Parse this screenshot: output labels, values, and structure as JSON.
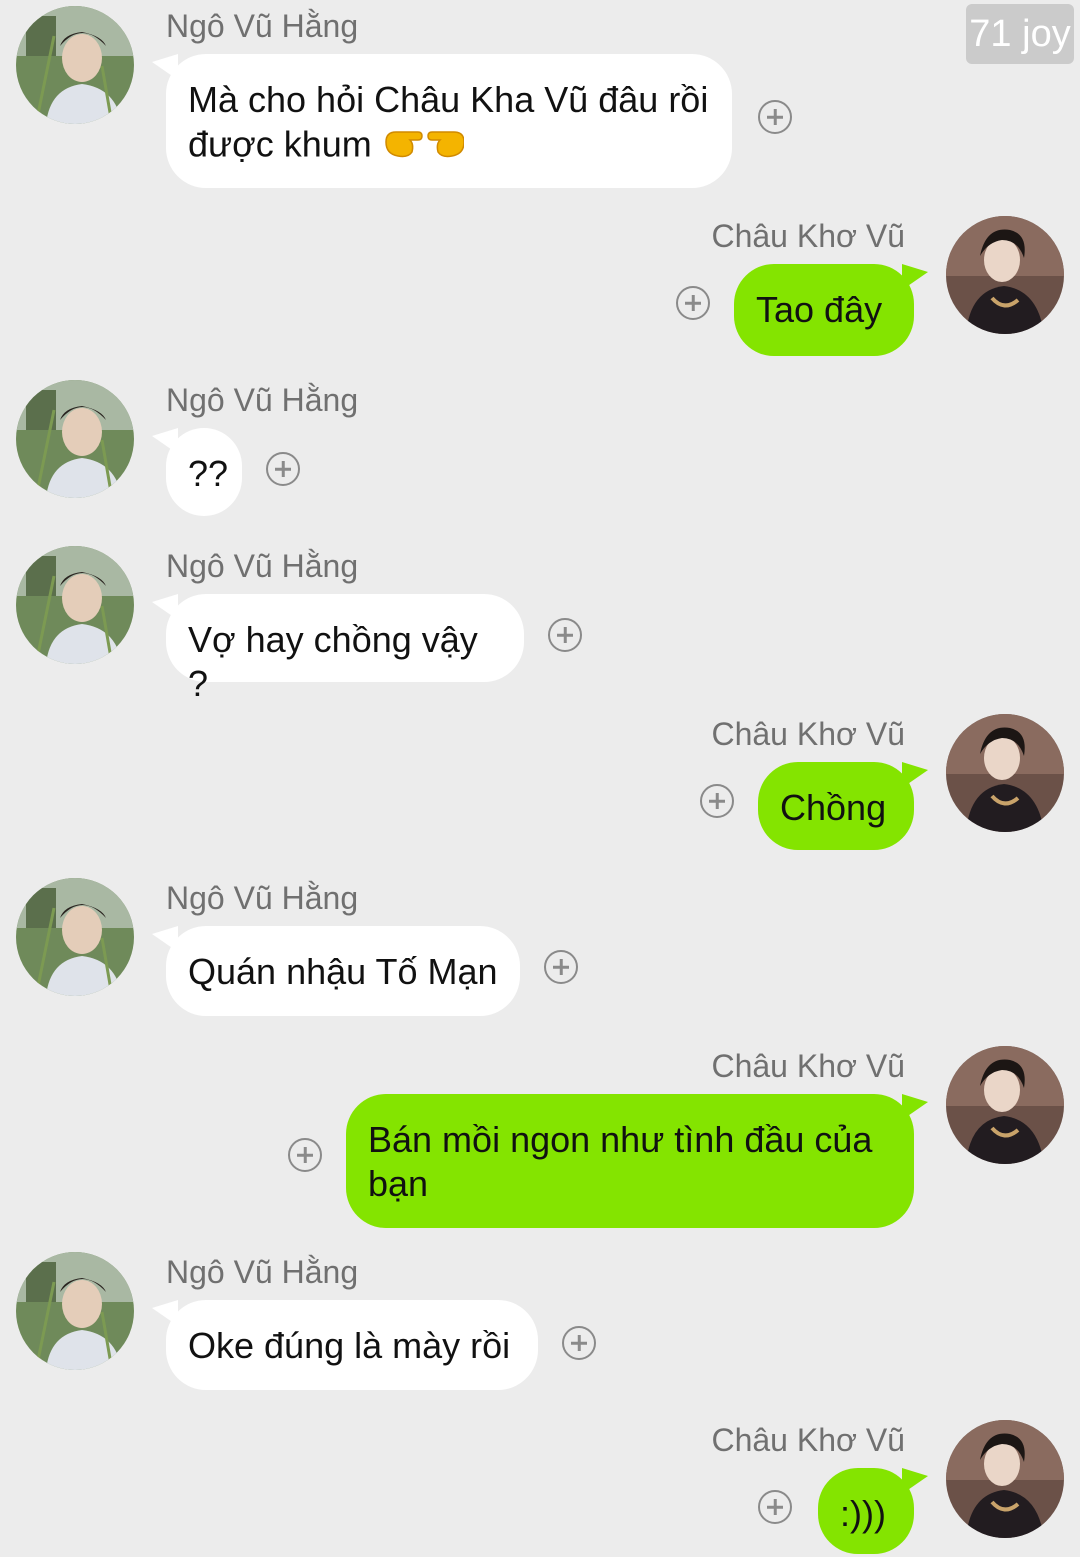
{
  "watermark": "71 joy",
  "messages": [
    {
      "side": "left",
      "sender": "Ngô Vũ Hằng",
      "text": "Mà cho hỏi Châu Kha Vũ đâu rồi được khum",
      "emoji": "👉👉"
    },
    {
      "side": "right",
      "sender": "Châu Khơ Vũ",
      "text": "Tao đây"
    },
    {
      "side": "left",
      "sender": "Ngô Vũ Hằng",
      "text": "??"
    },
    {
      "side": "left",
      "sender": "Ngô Vũ Hằng",
      "text": "Vợ hay chồng vậy ?"
    },
    {
      "side": "right",
      "sender": "Châu Khơ Vũ",
      "text": "Chồng"
    },
    {
      "side": "left",
      "sender": "Ngô Vũ Hằng",
      "text": "Quán nhậu Tố Mạn"
    },
    {
      "side": "right",
      "sender": "Châu Khơ Vũ",
      "text": "Bán mồi ngon như tình đầu của bạn"
    },
    {
      "side": "left",
      "sender": "Ngô Vũ Hằng",
      "text": "Oke đúng là mày rồi"
    },
    {
      "side": "right",
      "sender": "Châu Khơ Vũ",
      "text": ":)))"
    }
  ],
  "colors": {
    "background": "#ececec",
    "incoming_bubble": "#ffffff",
    "outgoing_bubble": "#84e400",
    "sender_text": "#707070",
    "add_icon": "#8a8a8a"
  },
  "icons": {
    "add_reaction": "plus-circle-icon",
    "avatar_left": "user-avatar",
    "avatar_right": "user-avatar"
  }
}
